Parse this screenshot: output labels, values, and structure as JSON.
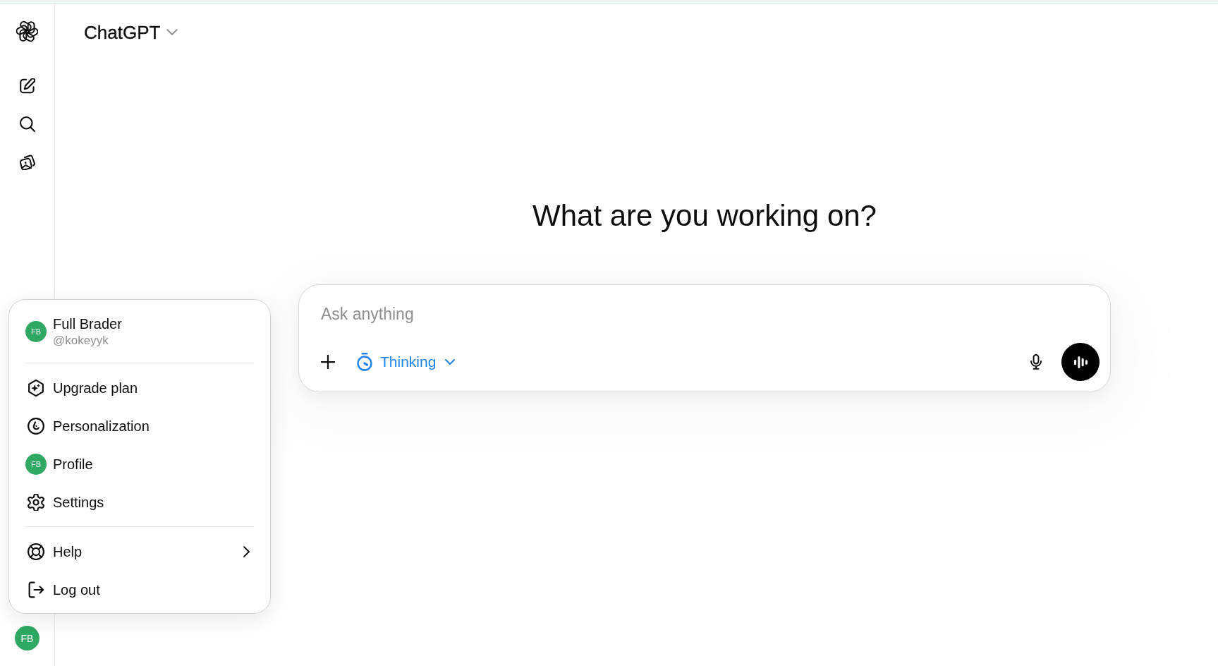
{
  "sidebar": {
    "avatar": {
      "initials": "FB"
    }
  },
  "header": {
    "title": "ChatGPT"
  },
  "heading": "What are you working on?",
  "composer": {
    "placeholder": "Ask anything",
    "mode": {
      "label": "Thinking",
      "active": true
    }
  },
  "account_menu": {
    "user": {
      "name": "Full Brader",
      "handle": "@kokeyyk",
      "initials": "FB"
    },
    "sections": [
      [
        {
          "label": "Upgrade plan",
          "kind": "icon",
          "submenu": false
        },
        {
          "label": "Personalization",
          "kind": "icon",
          "submenu": false
        },
        {
          "label": "Profile",
          "kind": "avatar",
          "initials": "FB",
          "submenu": false
        },
        {
          "label": "Settings",
          "kind": "icon",
          "submenu": false
        }
      ],
      [
        {
          "label": "Help",
          "kind": "icon",
          "submenu": true
        },
        {
          "label": "Log out",
          "kind": "icon",
          "submenu": false
        }
      ]
    ]
  }
}
